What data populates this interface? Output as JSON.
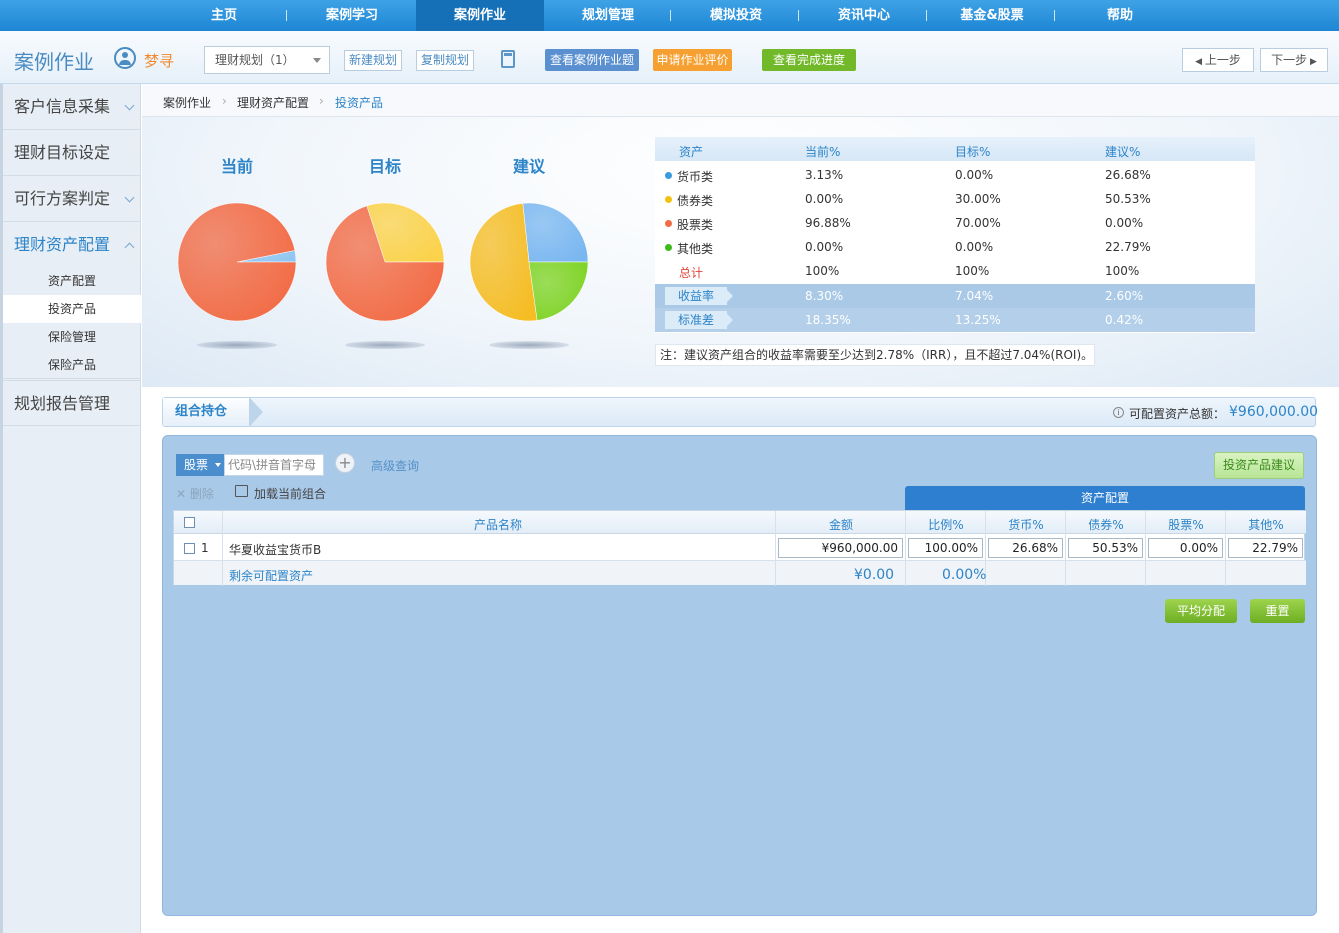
{
  "nav": {
    "items": [
      "主页",
      "案例学习",
      "案例作业",
      "规划管理",
      "模拟投资",
      "资讯中心",
      "基金&股票",
      "帮助"
    ],
    "active": "案例作业"
  },
  "toolbar": {
    "app_title": "案例作业",
    "user_name": "梦寻",
    "plan_select": "理财规划（1）",
    "new_plan": "新建规划",
    "copy_plan": "复制规划",
    "view_questions": "查看案例作业题",
    "apply_review": "申请作业评价",
    "view_progress": "查看完成进度",
    "prev_step": "上一步",
    "next_step": "下一步"
  },
  "sidebar": {
    "items": [
      "客户信息采集",
      "理财目标设定",
      "可行方案判定",
      "理财资产配置",
      "规划报告管理"
    ],
    "sub_items": [
      "资产配置",
      "投资产品",
      "保险管理",
      "保险产品"
    ],
    "active_sub": "投资产品"
  },
  "breadcrumb": {
    "items": [
      "案例作业",
      "理财资产配置",
      "投资产品"
    ]
  },
  "pies": [
    {
      "title": "当前",
      "slices": [
        {
          "name": "货币类",
          "pct": 3.13,
          "color": "#8ec5f2"
        },
        {
          "name": "股票类",
          "pct": 96.88,
          "color": "#f26b45"
        }
      ]
    },
    {
      "title": "目标",
      "slices": [
        {
          "name": "债券类",
          "pct": 30.0,
          "color": "#fbd24a"
        },
        {
          "name": "股票类",
          "pct": 70.0,
          "color": "#f26b45"
        }
      ]
    },
    {
      "title": "建议",
      "slices": [
        {
          "name": "货币类",
          "pct": 26.68,
          "color": "#7ab7f0"
        },
        {
          "name": "债券类",
          "pct": 50.53,
          "color": "#f5bd24"
        },
        {
          "name": "其他类",
          "pct": 22.79,
          "color": "#7ed323"
        }
      ]
    }
  ],
  "alloc": {
    "headers": [
      "资产",
      "当前%",
      "目标%",
      "建议%"
    ],
    "rows": [
      {
        "name": "货币类",
        "dot": "#3a9ae0",
        "current": "3.13%",
        "target": "0.00%",
        "suggest": "26.68%"
      },
      {
        "name": "债券类",
        "dot": "#f3c20f",
        "current": "0.00%",
        "target": "30.00%",
        "suggest": "50.53%"
      },
      {
        "name": "股票类",
        "dot": "#f26b45",
        "current": "96.88%",
        "target": "70.00%",
        "suggest": "0.00%"
      },
      {
        "name": "其他类",
        "dot": "#3dbb1c",
        "current": "0.00%",
        "target": "0.00%",
        "suggest": "22.79%"
      }
    ],
    "total": {
      "name": "总计",
      "current": "100%",
      "target": "100%",
      "suggest": "100%"
    },
    "return": {
      "name": "收益率",
      "current": "8.30%",
      "target": "7.04%",
      "suggest": "2.60%"
    },
    "std": {
      "name": "标准差",
      "current": "18.35%",
      "target": "13.25%",
      "suggest": "0.42%"
    },
    "note": "注：建议资产组合的收益率需要至少达到2.78%（IRR），且不超过7.04%(ROI)。"
  },
  "holdings": {
    "title": "组合持仓",
    "total_label": "可配置资产总额：",
    "total_value": "¥960,000.00",
    "category": "股票",
    "code_placeholder": "代码\\拼音首字母",
    "advanced": "高级查询",
    "suggest_btn": "投资产品建议",
    "delete": "删除",
    "load_combo": "加载当前组合",
    "asset_config": "资产配置",
    "headers": [
      "产品名称",
      "金额",
      "比例%",
      "货币%",
      "债券%",
      "股票%",
      "其他%"
    ],
    "row": {
      "index": "1",
      "name": "华夏收益宝货币B",
      "amount": "¥960,000.00",
      "ratio": "100.00%",
      "money": "26.68%",
      "bond": "50.53%",
      "stock": "0.00%",
      "other": "22.79%"
    },
    "remain": {
      "label": "剩余可配置资产",
      "amount": "¥0.00",
      "ratio": "0.00%"
    },
    "avg_btn": "平均分配",
    "reset_btn": "重置"
  }
}
